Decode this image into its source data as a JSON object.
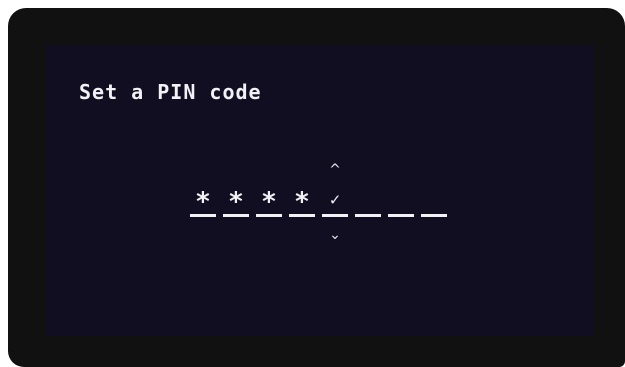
{
  "title": "Set a PIN code",
  "pin": {
    "slots": [
      "*",
      "*",
      "*",
      "*",
      "✓",
      "",
      "",
      ""
    ],
    "active_index": 4,
    "up_glyph": "^",
    "down_glyph": "⌄"
  },
  "colors": {
    "screen_bg": "#120e21",
    "bezel": "#111111",
    "text": "#f2f2f4"
  }
}
